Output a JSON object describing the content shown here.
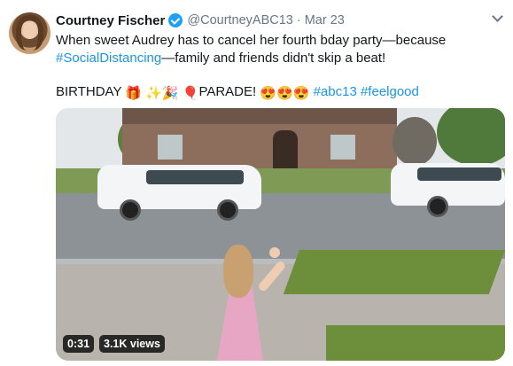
{
  "tweet": {
    "author_name": "Courtney Fischer",
    "handle": "@CourtneyABC13",
    "separator": "·",
    "date": "Mar 23",
    "line1": "When sweet Audrey has to cancel her fourth bday party—because",
    "hashtag_social": "#SocialDistancing",
    "line2_rest": "—family and friends didn't skip a beat!",
    "birthday_word": "BIRTHDAY",
    "emoji_gift": "🎁",
    "emoji_sparkles": "✨",
    "emoji_party": "🎉",
    "emoji_balloon": "🎈",
    "parade_word": "PARADE!",
    "emoji_heart_eyes": "😍😍😍",
    "hashtag_abc13": "#abc13",
    "hashtag_feelgood": "#feelgood"
  },
  "video": {
    "duration": "0:31",
    "views": "3.1K views"
  },
  "icons": {
    "verified": "verified-badge-icon",
    "menu": "chevron-down-icon"
  },
  "colors": {
    "link": "#1b95e0",
    "verified": "#1da1f2",
    "meta_text": "#657786"
  }
}
